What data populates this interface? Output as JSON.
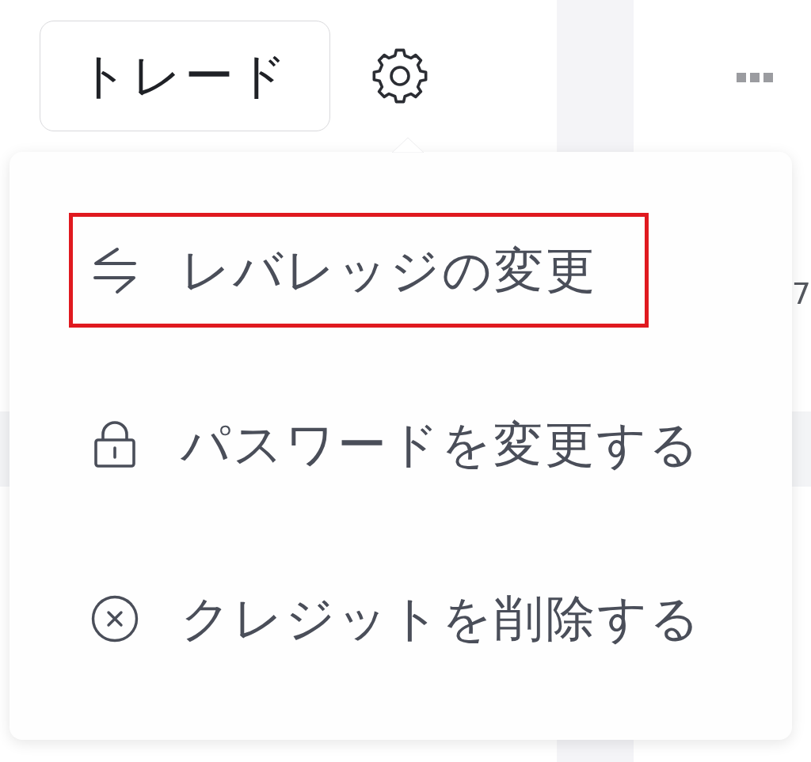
{
  "toolbar": {
    "trade_button": "トレード"
  },
  "background": {
    "partial_text": "7"
  },
  "menu": {
    "items": [
      {
        "kind": "leverage",
        "label": "レバレッジの変更",
        "highlighted": true
      },
      {
        "kind": "password",
        "label": "パスワードを変更する",
        "highlighted": false
      },
      {
        "kind": "delete",
        "label": "クレジットを削除する",
        "highlighted": false
      }
    ]
  }
}
